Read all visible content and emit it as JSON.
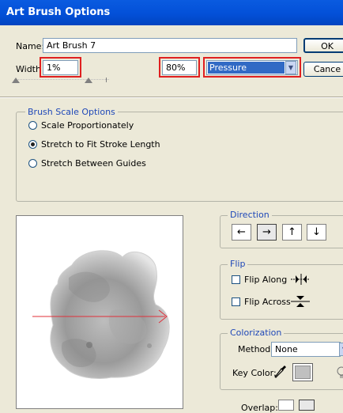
{
  "window": {
    "title": "Art Brush Options"
  },
  "name_field": {
    "label": "Name:",
    "value": "Art Brush 7"
  },
  "buttons": {
    "ok": "OK",
    "cancel": "Cance"
  },
  "width": {
    "label": "Width",
    "min_value": "1%",
    "max_value": "80%",
    "variation": "Pressure"
  },
  "brush_scale": {
    "title": "Brush Scale Options",
    "options": [
      "Scale Proportionately",
      "Stretch to Fit Stroke Length",
      "Stretch Between Guides"
    ],
    "selected": "Stretch to Fit Stroke Length"
  },
  "direction": {
    "title": "Direction",
    "arrows": [
      "←",
      "→",
      "↑",
      "↓"
    ],
    "selected": "→"
  },
  "flip": {
    "title": "Flip",
    "along_label": "Flip Along",
    "across_label": "Flip Across",
    "along_checked": false,
    "across_checked": false
  },
  "colorization": {
    "title": "Colorization",
    "method_label": "Method:",
    "method_value": "None",
    "key_color_label": "Key Color:",
    "key_color": "#c0c0c0"
  },
  "overlap": {
    "label": "Overlap:"
  },
  "colors": {
    "titlebar": "#0350d8",
    "highlight": "#e02020",
    "group_title": "#1f48b8",
    "preview_arrow": "#e0303a"
  }
}
